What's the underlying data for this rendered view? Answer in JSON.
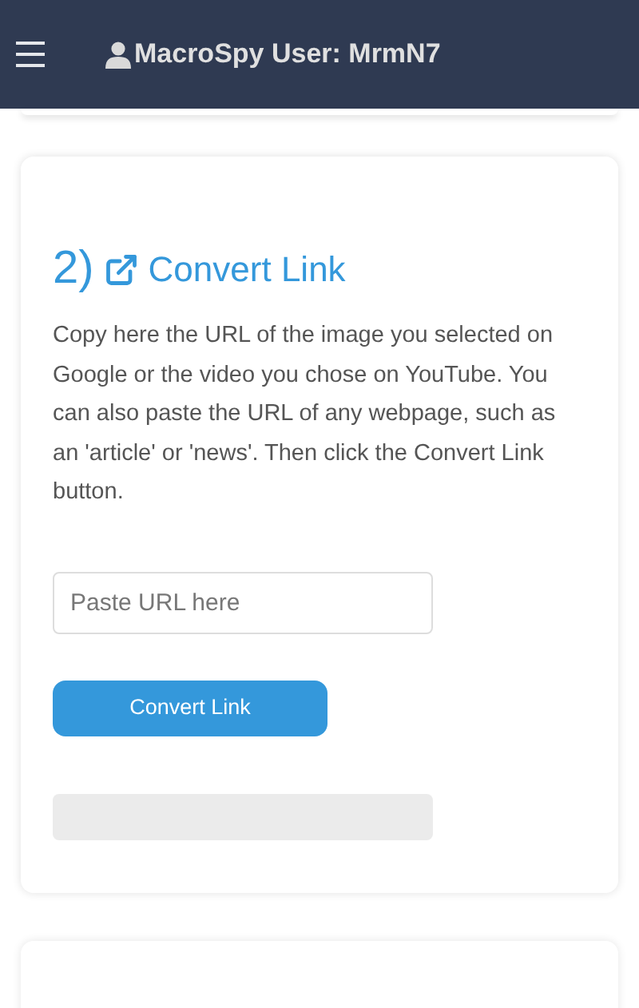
{
  "header": {
    "title": "MacroSpy User: MrmN7"
  },
  "card": {
    "step": "2)",
    "heading": "Convert Link",
    "description": "Copy here the URL of the image you selected on Google or the video you chose on YouTube. You can also paste the URL of any webpage, such as an 'article' or 'news'. Then click the Convert Link button.",
    "url_field": {
      "placeholder": "Paste URL here"
    },
    "button": "Convert Link"
  }
}
